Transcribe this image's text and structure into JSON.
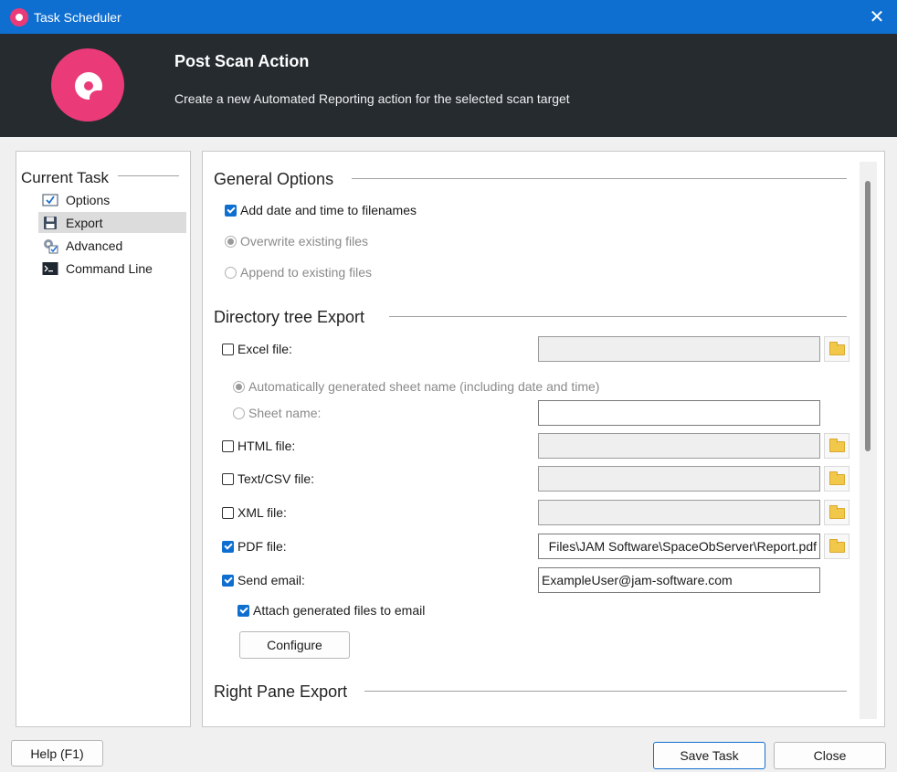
{
  "window": {
    "title": "Task Scheduler",
    "close_glyph": "✕"
  },
  "banner": {
    "title": "Post Scan Action",
    "subtitle": "Create a new Automated Reporting action for the selected scan target"
  },
  "nav": {
    "heading": "Current Task",
    "items": [
      {
        "label": "Options",
        "icon": "checkbox-icon",
        "selected": false
      },
      {
        "label": "Export",
        "icon": "floppy-disk-icon",
        "selected": true
      },
      {
        "label": "Advanced",
        "icon": "gear-icon",
        "selected": false
      },
      {
        "label": "Command Line",
        "icon": "terminal-icon",
        "selected": false
      }
    ]
  },
  "general": {
    "title": "General Options",
    "add_date": {
      "label": "Add date and time to filenames",
      "checked": true
    },
    "overwrite": {
      "label": "Overwrite existing files",
      "checked": true,
      "enabled": false
    },
    "append": {
      "label": "Append to existing files",
      "checked": false,
      "enabled": false
    }
  },
  "dirtree": {
    "title": "Directory tree Export",
    "excel": {
      "label": "Excel file:",
      "checked": false,
      "value": ""
    },
    "auto_sheet": {
      "label": "Automatically generated sheet name (including date and time)",
      "checked": true
    },
    "sheet_name": {
      "label": "Sheet name:",
      "checked": false,
      "value": ""
    },
    "html": {
      "label": "HTML file:",
      "checked": false,
      "value": ""
    },
    "text_csv": {
      "label": "Text/CSV file:",
      "checked": false,
      "value": ""
    },
    "xml": {
      "label": "XML file:",
      "checked": false,
      "value": ""
    },
    "pdf": {
      "label": "PDF file:",
      "checked": true,
      "value": "Files\\JAM Software\\SpaceObServer\\Report.pdf"
    },
    "email": {
      "label": "Send email:",
      "checked": true,
      "value": "ExampleUser@jam-software.com"
    },
    "attach": {
      "label": "Attach generated files to email",
      "checked": true
    },
    "configure_label": "Configure"
  },
  "rightpane": {
    "title": "Right Pane Export"
  },
  "footer": {
    "help_label": "Help (F1)",
    "save_label": "Save Task",
    "close_label": "Close"
  },
  "colors": {
    "titlebar": "#0f6fd0",
    "banner": "#262b30",
    "brand": "#ea3a78",
    "checkbox_checked": "#0f6fd0"
  }
}
